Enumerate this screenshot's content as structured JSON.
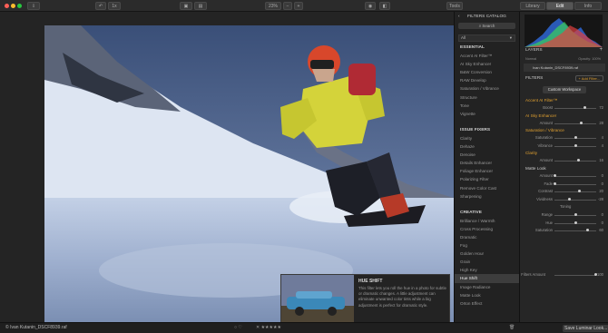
{
  "toolbar": {
    "zoom": "23%",
    "minus": "−",
    "plus": "+",
    "tools": "Tools",
    "tabs": [
      "Library",
      "Edit",
      "Info"
    ],
    "count_label": "1x"
  },
  "catalog": {
    "title": "FILTERS CATALOG",
    "search_placeholder": "Search",
    "dropdown": "All",
    "sections": [
      {
        "title": "ESSENTIAL",
        "items": [
          "Accent AI Filter™",
          "AI Sky Enhancer",
          "B&W Conversion",
          "RAW Develop",
          "Saturation / Vibrance",
          "Structure",
          "Tone",
          "Vignette"
        ]
      },
      {
        "title": "ISSUE FIXERS",
        "items": [
          "Clarity",
          "Dehaze",
          "Denoise",
          "Details Enhancer",
          "Foliage Enhancer",
          "Polarizing Filter",
          "Remove Color Cast",
          "Sharpening"
        ]
      },
      {
        "title": "CREATIVE",
        "items": [
          "Brilliance / Warmth",
          "Cross Processing",
          "Dramatic",
          "Fog",
          "Golden Hour",
          "Grain",
          "High Key",
          "Hue Shift",
          "Image Radiance",
          "Matte Look",
          "Orton Effect"
        ]
      }
    ],
    "selected": "Hue Shift"
  },
  "tooltip": {
    "title": "HUE SHIFT",
    "body": "This filter lets you roll the hue in a photo for subtle or dramatic changes. A little adjustment can eliminate unwanted color tints while a big adjustment is perfect for dramatic style."
  },
  "layers": {
    "title": "LAYERS",
    "blend": "Normal",
    "opacity": "Opacity: 100%",
    "layer_name": "Ivan Kutanin_DSCF8939.raf"
  },
  "filters": {
    "title": "FILTERS",
    "add_button": "+ Add Filter...",
    "workspace": "Custom Workspace",
    "groups": [
      {
        "name": "Accent AI Filter™",
        "color": "#e0a030",
        "rows": [
          {
            "label": "Boost",
            "value": "72",
            "pos": 0.72
          }
        ]
      },
      {
        "name": "AI Sky Enhancer",
        "color": "#e0a030",
        "rows": [
          {
            "label": "Amount",
            "value": "28",
            "pos": 0.64
          }
        ]
      },
      {
        "name": "Saturation / Vibrance",
        "color": "#e0a030",
        "rows": [
          {
            "label": "Saturation",
            "value": "4",
            "pos": 0.52
          },
          {
            "label": "Vibrance",
            "value": "4",
            "pos": 0.52
          }
        ]
      },
      {
        "name": "Clarity",
        "color": "#e0a030",
        "rows": [
          {
            "label": "Amount",
            "value": "16",
            "pos": 0.58
          }
        ]
      },
      {
        "name": "Matte Look",
        "color": "#cccccc",
        "rows": [
          {
            "label": "Amount",
            "value": "0",
            "pos": 0.0
          },
          {
            "label": "Fade",
            "value": "0",
            "pos": 0.0
          },
          {
            "label": "Contrast",
            "value": "20",
            "pos": 0.6
          },
          {
            "label": "Vividness",
            "value": "-28",
            "pos": 0.36
          },
          {
            "label": "Toning",
            "value": "",
            "pos": -1
          },
          {
            "label": "Range",
            "value": "0",
            "pos": 0.5
          },
          {
            "label": "Hue",
            "value": "0",
            "pos": 0.5
          },
          {
            "label": "Saturation",
            "value": "60",
            "pos": 0.8
          }
        ]
      }
    ],
    "filters_amount_label": "Filters Amount",
    "filters_amount_value": "100"
  },
  "status": {
    "filename": "© Ivan Kutanin_DSCF8939.raf",
    "rating": "✕ ★★★★★",
    "save_button": "Save Luminar Look..."
  }
}
